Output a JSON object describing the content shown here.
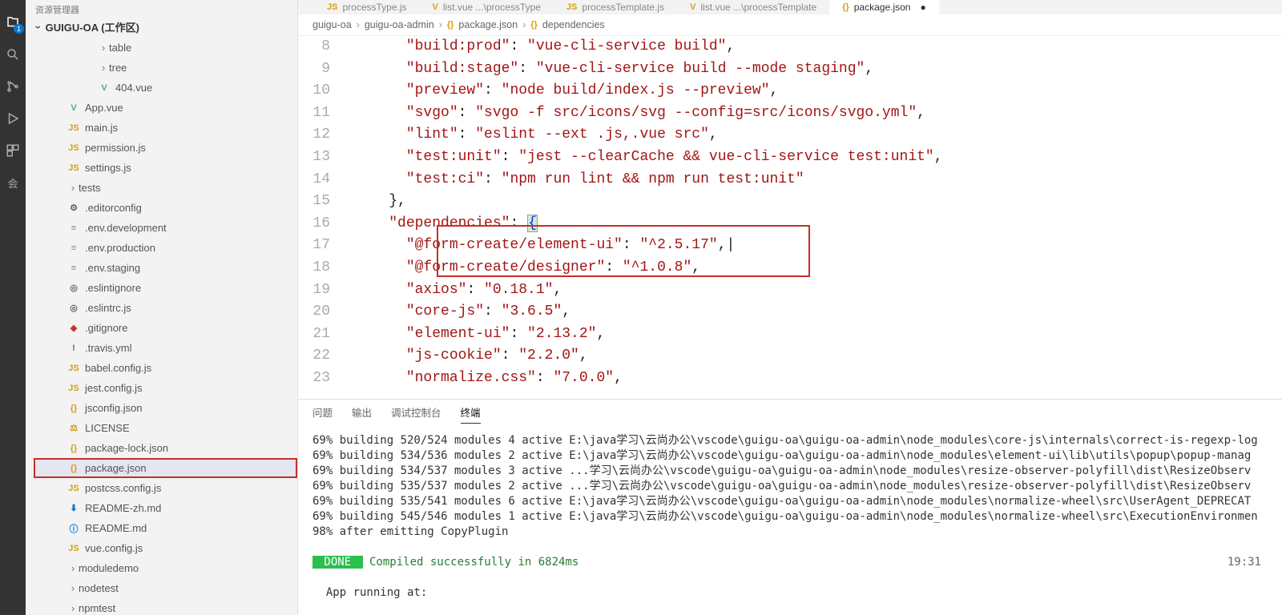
{
  "activityBadge": "1",
  "sidebarTitle": "资源管理器",
  "workspace": "GUIGU-OA (工作区)",
  "tree": [
    {
      "name": "table",
      "type": "folder",
      "level": "deep",
      "chev": "›"
    },
    {
      "name": "tree",
      "type": "folder",
      "level": "deep",
      "chev": "›"
    },
    {
      "name": "404.vue",
      "type": "file",
      "icon": "vue",
      "glyph": "V",
      "level": "deep"
    },
    {
      "name": "App.vue",
      "type": "file",
      "icon": "vue",
      "glyph": "V",
      "level": "root"
    },
    {
      "name": "main.js",
      "type": "file",
      "icon": "js",
      "glyph": "JS",
      "level": "root"
    },
    {
      "name": "permission.js",
      "type": "file",
      "icon": "js",
      "glyph": "JS",
      "level": "root"
    },
    {
      "name": "settings.js",
      "type": "file",
      "icon": "js",
      "glyph": "JS",
      "level": "root"
    },
    {
      "name": "tests",
      "type": "folder",
      "level": "root",
      "chev": "›"
    },
    {
      "name": ".editorconfig",
      "type": "file",
      "icon": "ed",
      "glyph": "⚙",
      "level": "root"
    },
    {
      "name": ".env.development",
      "type": "file",
      "icon": "config",
      "glyph": "≡",
      "level": "root"
    },
    {
      "name": ".env.production",
      "type": "file",
      "icon": "config",
      "glyph": "≡",
      "level": "root"
    },
    {
      "name": ".env.staging",
      "type": "file",
      "icon": "config",
      "glyph": "≡",
      "level": "root"
    },
    {
      "name": ".eslintignore",
      "type": "file",
      "icon": "ed",
      "glyph": "◎",
      "level": "root"
    },
    {
      "name": ".eslintrc.js",
      "type": "file",
      "icon": "ed",
      "glyph": "◎",
      "level": "root"
    },
    {
      "name": ".gitignore",
      "type": "file",
      "icon": "git",
      "glyph": "◆",
      "level": "root"
    },
    {
      "name": ".travis.yml",
      "type": "file",
      "icon": "yml",
      "glyph": "!",
      "level": "root"
    },
    {
      "name": "babel.config.js",
      "type": "file",
      "icon": "js",
      "glyph": "JS",
      "level": "root"
    },
    {
      "name": "jest.config.js",
      "type": "file",
      "icon": "js",
      "glyph": "JS",
      "level": "root"
    },
    {
      "name": "jsconfig.json",
      "type": "file",
      "icon": "json",
      "glyph": "{}",
      "level": "root"
    },
    {
      "name": "LICENSE",
      "type": "file",
      "icon": "license",
      "glyph": "⚖",
      "level": "root"
    },
    {
      "name": "package-lock.json",
      "type": "file",
      "icon": "json",
      "glyph": "{}",
      "level": "root"
    },
    {
      "name": "package.json",
      "type": "file",
      "icon": "json",
      "glyph": "{}",
      "level": "root",
      "selected": true
    },
    {
      "name": "postcss.config.js",
      "type": "file",
      "icon": "js",
      "glyph": "JS",
      "level": "root"
    },
    {
      "name": "README-zh.md",
      "type": "file",
      "icon": "readme",
      "glyph": "⬇",
      "level": "root"
    },
    {
      "name": "README.md",
      "type": "file",
      "icon": "readme",
      "glyph": "ⓘ",
      "level": "root"
    },
    {
      "name": "vue.config.js",
      "type": "file",
      "icon": "js",
      "glyph": "JS",
      "level": "root"
    },
    {
      "name": "moduledemo",
      "type": "folder",
      "level": "root",
      "chev": "›"
    },
    {
      "name": "nodetest",
      "type": "folder",
      "level": "root",
      "chev": "›"
    },
    {
      "name": "npmtest",
      "type": "folder",
      "level": "root",
      "chev": "›"
    }
  ],
  "tabs": [
    {
      "label": "processType.js",
      "glyph": "JS"
    },
    {
      "label": "list.vue  ...\\processType",
      "glyph": "V"
    },
    {
      "label": "processTemplate.js",
      "glyph": "JS"
    },
    {
      "label": "list.vue  ...\\processTemplate",
      "glyph": "V"
    },
    {
      "label": "package.json",
      "glyph": "{}",
      "active": true
    }
  ],
  "breadcrumb": {
    "p1": "guigu-oa",
    "p2": "guigu-oa-admin",
    "p3": "package.json",
    "p4": "dependencies"
  },
  "code": {
    "startLine": 8,
    "lines": [
      {
        "n": 8,
        "indent": "      ",
        "k": "\"build:prod\"",
        "v": "\"vue-cli-service build\"",
        "comma": true
      },
      {
        "n": 9,
        "indent": "      ",
        "k": "\"build:stage\"",
        "v": "\"vue-cli-service build --mode staging\"",
        "comma": true
      },
      {
        "n": 10,
        "indent": "      ",
        "k": "\"preview\"",
        "v": "\"node build/index.js --preview\"",
        "comma": true
      },
      {
        "n": 11,
        "indent": "      ",
        "k": "\"svgo\"",
        "v": "\"svgo -f src/icons/svg --config=src/icons/svgo.yml\"",
        "comma": true
      },
      {
        "n": 12,
        "indent": "      ",
        "k": "\"lint\"",
        "v": "\"eslint --ext .js,.vue src\"",
        "comma": true
      },
      {
        "n": 13,
        "indent": "      ",
        "k": "\"test:unit\"",
        "v": "\"jest --clearCache && vue-cli-service test:unit\"",
        "comma": true
      },
      {
        "n": 14,
        "indent": "      ",
        "k": "\"test:ci\"",
        "v": "\"npm run lint && npm run test:unit\""
      },
      {
        "n": 15,
        "raw": "    },"
      },
      {
        "n": 16,
        "indent": "    ",
        "k": "\"dependencies\"",
        "open": true
      },
      {
        "n": 17,
        "indent": "      ",
        "k": "\"@form-create/element-ui\"",
        "v": "\"^2.5.17\"",
        "comma": true,
        "caret": true
      },
      {
        "n": 18,
        "indent": "      ",
        "k": "\"@form-create/designer\"",
        "v": "\"^1.0.8\"",
        "comma": true
      },
      {
        "n": 19,
        "indent": "      ",
        "k": "\"axios\"",
        "v": "\"0.18.1\"",
        "comma": true
      },
      {
        "n": 20,
        "indent": "      ",
        "k": "\"core-js\"",
        "v": "\"3.6.5\"",
        "comma": true
      },
      {
        "n": 21,
        "indent": "      ",
        "k": "\"element-ui\"",
        "v": "\"2.13.2\"",
        "comma": true
      },
      {
        "n": 22,
        "indent": "      ",
        "k": "\"js-cookie\"",
        "v": "\"2.2.0\"",
        "comma": true
      },
      {
        "n": 23,
        "indent": "      ",
        "k": "\"normalize.css\"",
        "v": "\"7.0.0\"",
        "comma": true
      }
    ]
  },
  "panelTabs": {
    "t1": "问题",
    "t2": "输出",
    "t3": "调试控制台",
    "t4": "终端"
  },
  "terminal": {
    "lines": [
      "69% building 520/524 modules 4 active E:\\java学习\\云尚办公\\vscode\\guigu-oa\\guigu-oa-admin\\node_modules\\core-js\\internals\\correct-is-regexp-log",
      "69% building 534/536 modules 2 active E:\\java学习\\云尚办公\\vscode\\guigu-oa\\guigu-oa-admin\\node_modules\\element-ui\\lib\\utils\\popup\\popup-manag",
      "69% building 534/537 modules 3 active ...学习\\云尚办公\\vscode\\guigu-oa\\guigu-oa-admin\\node_modules\\resize-observer-polyfill\\dist\\ResizeObserv",
      "69% building 535/537 modules 2 active ...学习\\云尚办公\\vscode\\guigu-oa\\guigu-oa-admin\\node_modules\\resize-observer-polyfill\\dist\\ResizeObserv",
      "69% building 535/541 modules 6 active E:\\java学习\\云尚办公\\vscode\\guigu-oa\\guigu-oa-admin\\node_modules\\normalize-wheel\\src\\UserAgent_DEPRECAT",
      "69% building 545/546 modules 1 active E:\\java学习\\云尚办公\\vscode\\guigu-oa\\guigu-oa-admin\\node_modules\\normalize-wheel\\src\\ExecutionEnvironmen",
      "98% after emitting CopyPlugin"
    ],
    "done": " DONE ",
    "doneMsg": " Compiled successfully in 6824ms",
    "time": "19:31",
    "running": "  App running at:"
  }
}
